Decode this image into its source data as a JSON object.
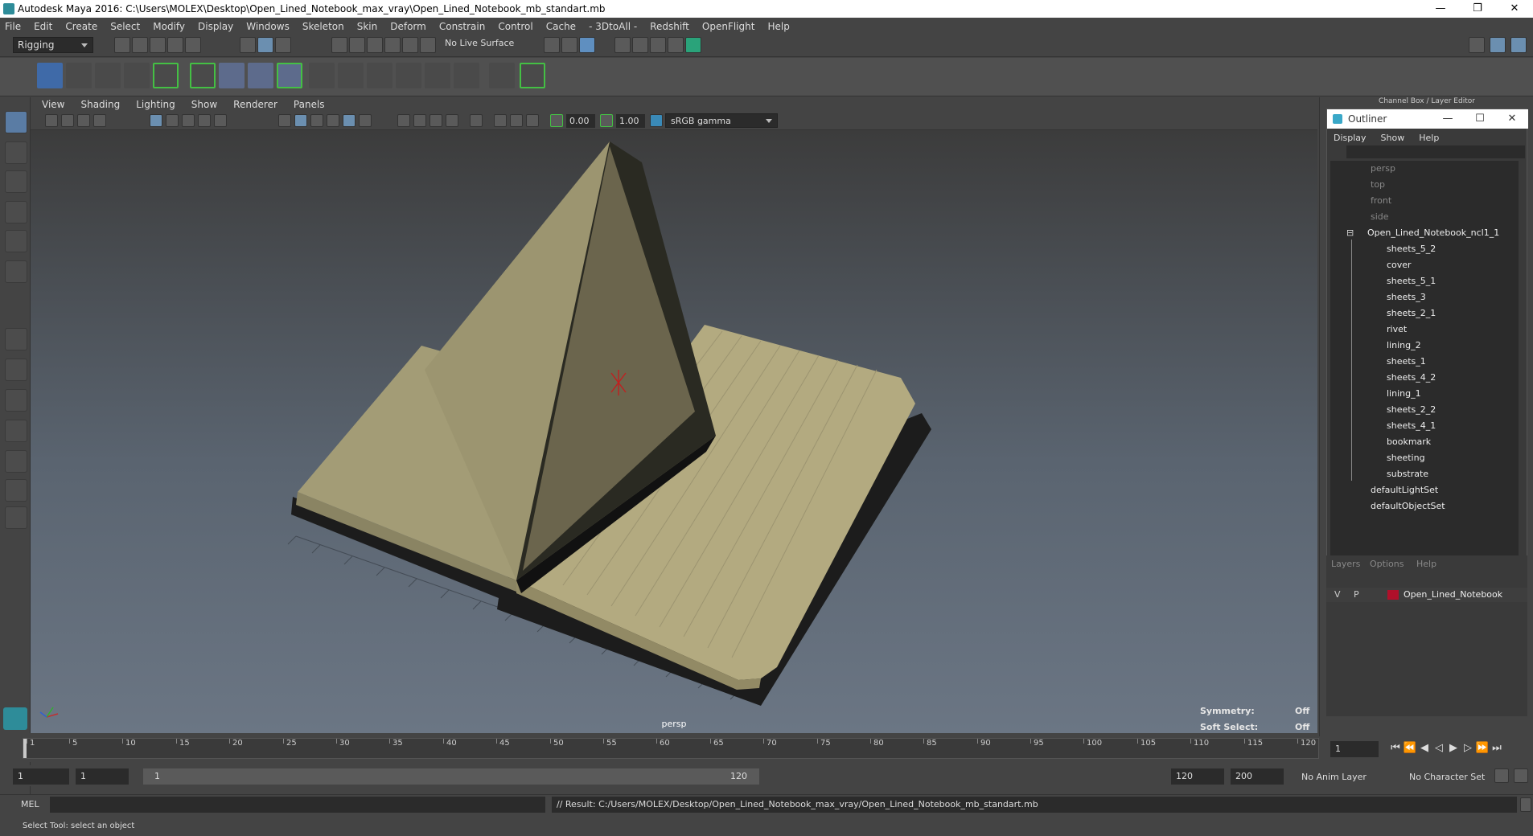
{
  "window": {
    "title": "Autodesk Maya 2016: C:\\Users\\MOLEX\\Desktop\\Open_Lined_Notebook_max_vray\\Open_Lined_Notebook_mb_standart.mb",
    "minimize": "—",
    "restore": "❐",
    "close": "✕"
  },
  "menubar": [
    "File",
    "Edit",
    "Create",
    "Select",
    "Modify",
    "Display",
    "Windows",
    "Skeleton",
    "Skin",
    "Deform",
    "Constrain",
    "Control",
    "Cache",
    "- 3DtoAll -",
    "Redshift",
    "OpenFlight",
    "Help"
  ],
  "toolbar": {
    "mode": "Rigging",
    "live_surface": "No Live Surface"
  },
  "panel_menu": [
    "View",
    "Shading",
    "Lighting",
    "Show",
    "Renderer",
    "Panels"
  ],
  "viewport": {
    "exposure": "0.00",
    "gamma_value": "1.00",
    "color_space": "sRGB gamma",
    "camera_label": "persp",
    "hud": {
      "symmetry_label": "Symmetry:",
      "symmetry_value": "Off",
      "soft_select_label": "Soft Select:",
      "soft_select_value": "Off"
    }
  },
  "channel_box_title": "Channel Box / Layer Editor",
  "outliner": {
    "title": "Outliner",
    "menu": [
      "Display",
      "Show",
      "Help"
    ],
    "cameras": [
      "persp",
      "top",
      "front",
      "side"
    ],
    "group": "Open_Lined_Notebook_ncl1_1",
    "children": [
      "sheets_5_2",
      "cover",
      "sheets_5_1",
      "sheets_3",
      "sheets_2_1",
      "rivet",
      "lining_2",
      "sheets_1",
      "sheets_4_2",
      "lining_1",
      "sheets_2_2",
      "sheets_4_1",
      "bookmark",
      "sheeting",
      "substrate"
    ],
    "sets": [
      "defaultLightSet",
      "defaultObjectSet"
    ]
  },
  "layers": {
    "menu": [
      "Layers",
      "Options",
      "Help"
    ],
    "row": {
      "v": "V",
      "p": "P",
      "name": "Open_Lined_Notebook",
      "color": "#b0102a"
    }
  },
  "timeline": {
    "ticks": [
      "1",
      "5",
      "10",
      "15",
      "20",
      "25",
      "30",
      "35",
      "40",
      "45",
      "50",
      "55",
      "60",
      "65",
      "70",
      "75",
      "80",
      "85",
      "90",
      "95",
      "100",
      "105",
      "110",
      "115",
      "120"
    ],
    "current_frame": "1"
  },
  "range": {
    "start": "1",
    "playback_start": "1",
    "slider_start": "1",
    "slider_end": "120",
    "playback_end": "120",
    "end": "200",
    "anim_layer": "No Anim Layer",
    "character_set": "No Character Set"
  },
  "command": {
    "lang": "MEL",
    "result": "// Result: C:/Users/MOLEX/Desktop/Open_Lined_Notebook_max_vray/Open_Lined_Notebook_mb_standart.mb"
  },
  "status": "Select Tool: select an object"
}
